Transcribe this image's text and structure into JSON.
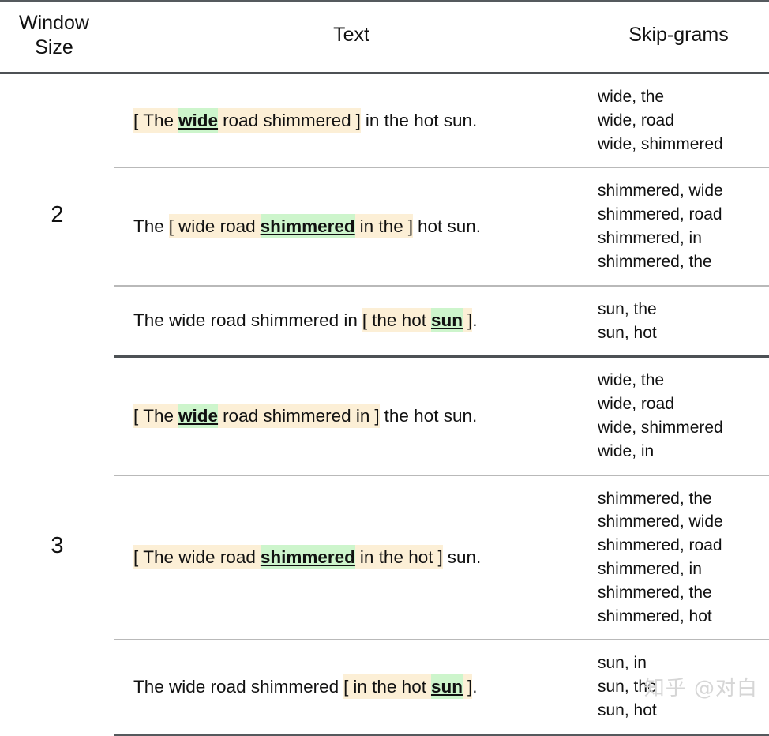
{
  "table": {
    "headers": {
      "window_size_line1": "Window",
      "window_size_line2": "Size",
      "text": "Text",
      "skipgrams": "Skip-grams"
    },
    "sections": [
      {
        "window_size": "2",
        "rows": [
          {
            "prefix": "",
            "bracket_open": "[",
            "before_target": "The",
            "target": "wide",
            "after_target": "road shimmered",
            "bracket_close": "]",
            "suffix": "in the hot sun.",
            "skipgrams": [
              "wide, the",
              "wide, road",
              "wide, shimmered"
            ]
          },
          {
            "prefix": "The",
            "bracket_open": "[",
            "before_target": "wide road",
            "target": "shimmered",
            "after_target": "in the",
            "bracket_close": "]",
            "suffix": "hot sun.",
            "skipgrams": [
              "shimmered, wide",
              "shimmered, road",
              "shimmered, in",
              "shimmered, the"
            ]
          },
          {
            "prefix": "The wide road shimmered in",
            "bracket_open": "[",
            "before_target": "the hot",
            "target": "sun",
            "after_target": "",
            "bracket_close": "]",
            "suffix": ".",
            "skipgrams": [
              "sun, the",
              "sun, hot"
            ]
          }
        ]
      },
      {
        "window_size": "3",
        "rows": [
          {
            "prefix": "",
            "bracket_open": "[",
            "before_target": "The",
            "target": "wide",
            "after_target": "road shimmered in",
            "bracket_close": "]",
            "suffix": "the hot sun.",
            "skipgrams": [
              "wide, the",
              "wide, road",
              "wide, shimmered",
              "wide, in"
            ]
          },
          {
            "prefix": "",
            "bracket_open": "[",
            "before_target": "The wide road",
            "target": "shimmered",
            "after_target": "in the hot",
            "bracket_close": "]",
            "suffix": "sun.",
            "skipgrams": [
              "shimmered, the",
              "shimmered, wide",
              "shimmered, road",
              "shimmered, in",
              "shimmered, the",
              "shimmered, hot"
            ]
          },
          {
            "prefix": "The wide road shimmered",
            "bracket_open": "[",
            "before_target": "in the hot",
            "target": "sun",
            "after_target": "",
            "bracket_close": "]",
            "suffix": ".",
            "skipgrams": [
              "sun, in",
              "sun, the",
              "sun, hot"
            ]
          }
        ]
      }
    ]
  },
  "watermark": {
    "text": "知乎 @对白"
  },
  "colors": {
    "window_highlight": "#fcefd6",
    "target_highlight": "#cdf5cc",
    "rule_heavy": "#4d5155",
    "rule_light": "#b9b9b9",
    "text": "#111111",
    "watermark": "#d6d6d6"
  }
}
